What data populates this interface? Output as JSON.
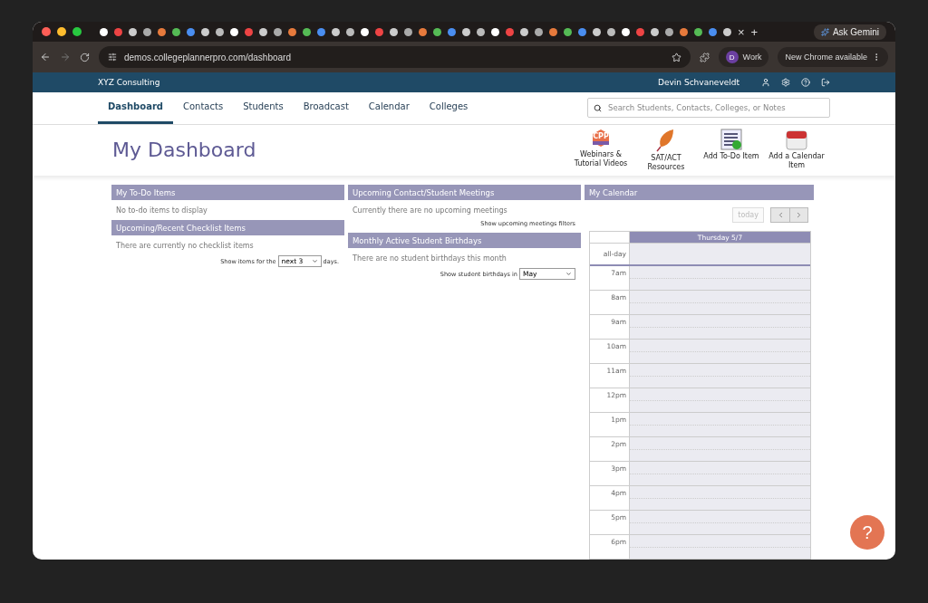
{
  "browser": {
    "tab_close": "×",
    "new_tab": "+",
    "gemini": "Ask Gemini",
    "url": "demos.collegeplannerpro.com/dashboard",
    "profile_initial": "D",
    "profile": "Work",
    "update": "New Chrome available"
  },
  "app_bar": {
    "company": "XYZ Consulting",
    "user": "Devin Schvaneveldt"
  },
  "nav": [
    {
      "label": "Dashboard",
      "selected": true
    },
    {
      "label": "Contacts",
      "selected": false
    },
    {
      "label": "Students",
      "selected": false
    },
    {
      "label": "Broadcast",
      "selected": false
    },
    {
      "label": "Calendar",
      "selected": false
    },
    {
      "label": "Colleges",
      "selected": false
    }
  ],
  "search": {
    "placeholder": "Search Students, Contacts, Colleges, or Notes"
  },
  "page_title": "My Dashboard",
  "quick_links": [
    {
      "kind": "webinar",
      "badge": "CPP",
      "label": "Webinars & Tutorial Videos"
    },
    {
      "kind": "leaf",
      "label": "SAT/ACT Resources"
    },
    {
      "kind": "todo",
      "label": "Add To-Do Item"
    },
    {
      "kind": "calendar",
      "label": "Add a Calendar Item"
    }
  ],
  "columns": [
    {
      "panels": [
        {
          "title": "My To-Do Items",
          "message": "No to-do items to display"
        },
        {
          "title": "Upcoming/Recent Checklist Items",
          "message": "There are currently no checklist items",
          "filter": {
            "prefix": "Show items for the",
            "value": "next 3",
            "suffix": "days."
          }
        }
      ]
    },
    {
      "panels": [
        {
          "title": "Upcoming Contact/Student Meetings",
          "message": "Currently there are no upcoming meetings",
          "link": "Show upcoming meetings filters"
        },
        {
          "title": "Monthly Active Student Birthdays",
          "message": "There are no student birthdays this month",
          "filter": {
            "prefix": "Show student birthdays in",
            "value": "May"
          }
        }
      ]
    }
  ],
  "calendar": {
    "title": "My Calendar",
    "today": "today",
    "day": "Thursday 5/7",
    "all_day": "all-day",
    "hours": [
      "7am",
      "8am",
      "9am",
      "10am",
      "11am",
      "12pm",
      "1pm",
      "2pm",
      "3pm",
      "4pm",
      "5pm",
      "6pm"
    ]
  },
  "help": "?"
}
